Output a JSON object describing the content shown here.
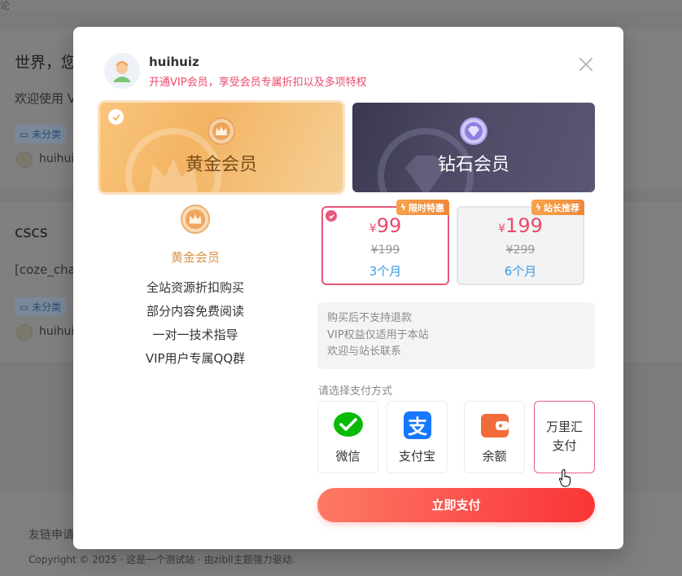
{
  "background": {
    "top_text": "论",
    "posts": [
      {
        "title": "世界，您",
        "desc": "欢迎使用 V",
        "tag": "未分类",
        "user": "huihuiz"
      },
      {
        "title": "cscs",
        "desc": "[coze_cha",
        "tag": "未分类",
        "user": "huihuiz"
      }
    ],
    "footer_links": "友链申请",
    "copyright": "Copyright © 2025 · 这是一个测试站 · 由zibll主题强力驱动."
  },
  "modal": {
    "user": {
      "name": "huihuiz",
      "subtitle": "开通VIP会员，享受会员专属折扣以及多项特权"
    },
    "tiers": [
      {
        "label": "黄金会员",
        "selected": true
      },
      {
        "label": "钻石会员",
        "selected": false
      }
    ],
    "left_panel": {
      "title": "黄金会员",
      "benefits": [
        "全站资源折扣购买",
        "部分内容免费阅读",
        "一对一技术指导",
        "VIP用户专属QQ群"
      ]
    },
    "prices": [
      {
        "badge": "限时特惠",
        "currency": "¥",
        "price": "99",
        "original": "¥199",
        "period": "3个月",
        "selected": true
      },
      {
        "badge": "站长推荐",
        "currency": "¥",
        "price": "199",
        "original": "¥299",
        "period": "6个月",
        "selected": false
      }
    ],
    "notice": [
      "购买后不支持退款",
      "VIP权益仅适用于本站",
      "欢迎与站长联系"
    ],
    "pay_label": "请选择支付方式",
    "pay_methods": [
      {
        "label": "微信",
        "icon": "wechat-icon",
        "color": "#09bb07"
      },
      {
        "label": "支付宝",
        "icon": "alipay-icon",
        "color": "#1677ff"
      },
      {
        "label": "余额",
        "icon": "wallet-icon",
        "color": "#f26b3a"
      },
      {
        "label_line1": "万里汇",
        "label_line2": "支付",
        "selected": true
      }
    ],
    "submit_label": "立即支付"
  },
  "colors": {
    "accent": "#e94a6b",
    "gold": "#f3b463",
    "submit": "#fb4e4c",
    "link": "#3a9be0"
  }
}
